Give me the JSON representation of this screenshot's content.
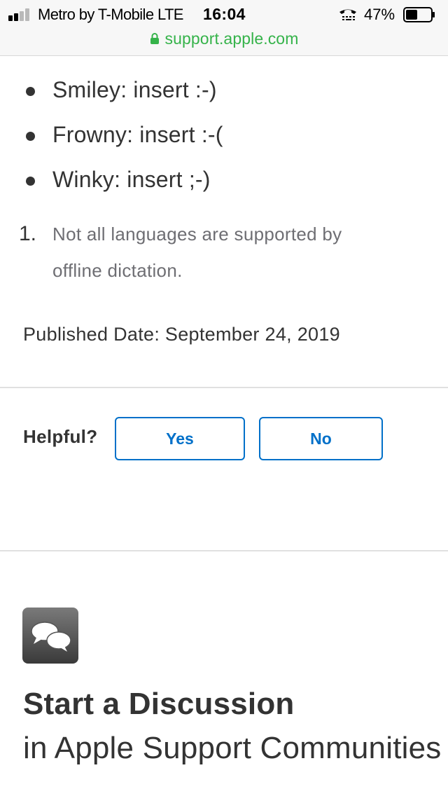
{
  "status_bar": {
    "carrier": "Metro by T-Mobile  LTE",
    "time": "16:04",
    "battery_percent": "47%",
    "battery_level": 0.47,
    "signal_bars": 2,
    "signal_icon": "cellular-signal-icon",
    "call_icon": "tty-phone-icon",
    "battery_icon": "battery-icon"
  },
  "url_bar": {
    "url": "support.apple.com",
    "lock_icon": "lock-icon",
    "url_color": "#35b34a"
  },
  "article": {
    "bullets": [
      {
        "label": "Smiley: insert :-)"
      },
      {
        "label": "Frowny: insert :-("
      },
      {
        "label": "Winky: insert ;-)"
      }
    ],
    "footnote": {
      "number": "1.",
      "text": "Not all languages are supported by offline dictation."
    },
    "published": "Published Date: September 24, 2019"
  },
  "feedback": {
    "label": "Helpful?",
    "yes_label": "Yes",
    "no_label": "No",
    "accent_color": "#0070c9"
  },
  "discussion": {
    "icon": "speech-bubbles-icon",
    "title": "Start a Discussion",
    "subtitle": "in Apple Support Communities"
  }
}
